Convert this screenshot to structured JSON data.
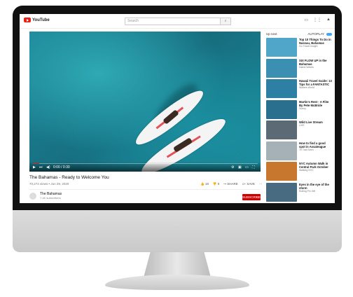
{
  "header": {
    "logo_text": "YouTube",
    "search_placeholder": "Search"
  },
  "video": {
    "title": "The Bahamas - Ready to Welcome You",
    "meta": "70,274 views • Jun 29, 2020",
    "time": "0:00 / 0:30",
    "progress": 0.03,
    "actions": [
      "19",
      "0",
      "SHARE",
      "SAVE"
    ]
  },
  "channel": {
    "name": "The Bahamas",
    "subs": "7.4K subscribers",
    "subscribe": "SUBSCRIBE"
  },
  "sidebar": {
    "up_next": "Up next",
    "autoplay": "AUTOPLAY",
    "items": [
      {
        "title": "Top 10 Things To Do in Nassau, Bahamas",
        "channel": "Go Travel Insight",
        "color": "#4fa6c9"
      },
      {
        "title": "SIX FLOW UP in the Bahamas",
        "channel": "Island Waves",
        "color": "#3b8fb0"
      },
      {
        "title": "Hawaii Travel Guide: 13 Tips for a FANTASTIC Trip to Oahu",
        "channel": "Wolters World",
        "color": "#2e7fa4"
      },
      {
        "title": "Martin's Rest - A Film By Pete McBride",
        "channel": "Sunny",
        "color": "#2a6f8e"
      },
      {
        "title": "Wild Live Stream",
        "channel": "LIVE",
        "color": "#5b6a74"
      },
      {
        "title": "How to find a good spot in Assateague Island Maryland",
        "channel": "Tri Trail Seen",
        "color": "#a6b0b7"
      },
      {
        "title": "NYC Autumn Walk in Central Park October 17, 2020",
        "channel": "Walking NYC",
        "color": "#c8782e"
      },
      {
        "title": "Eyes in the eye of the storm",
        "channel": "Rolling Pin Gift",
        "color": "#486b82"
      }
    ]
  }
}
